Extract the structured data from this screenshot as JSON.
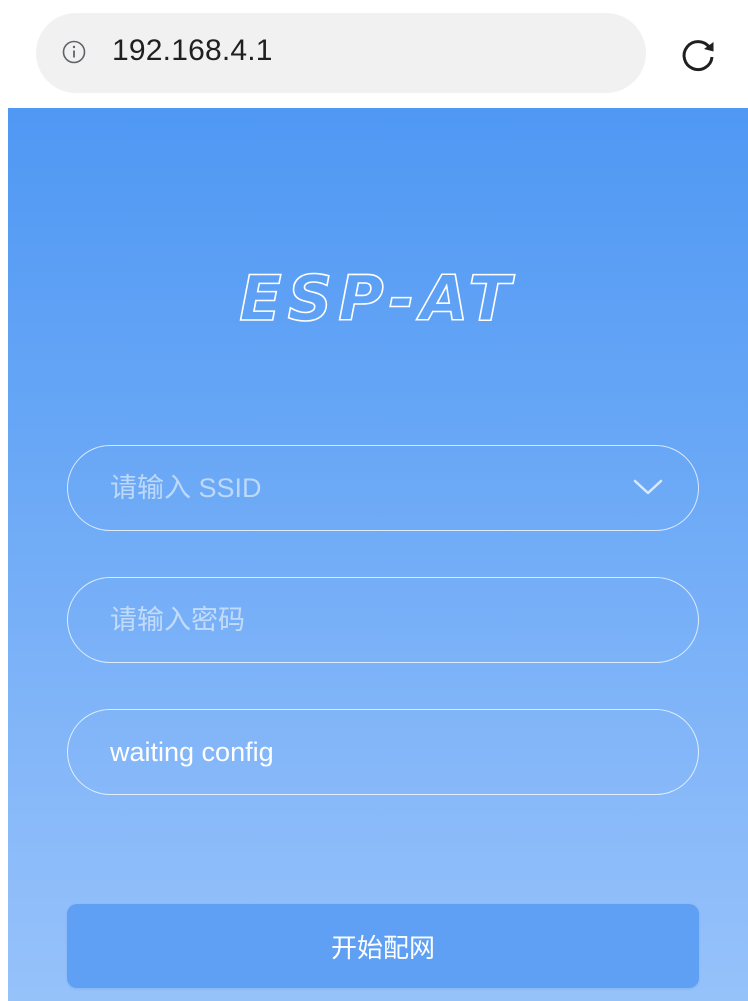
{
  "browser": {
    "url": "192.168.4.1",
    "info_icon": "info-icon",
    "reload_icon": "reload-icon"
  },
  "page": {
    "logo_text": "ESP-AT",
    "ssid": {
      "placeholder": "请输入 SSID",
      "value": "",
      "dropdown_icon": "chevron-down-icon"
    },
    "password": {
      "placeholder": "请输入密码",
      "value": ""
    },
    "status": {
      "text": "waiting config"
    },
    "submit_label": "开始配网"
  },
  "colors": {
    "gradient_top": "#4f98f4",
    "gradient_bottom": "#96c2fa",
    "button": "#5fa0f4",
    "text": "#ffffff"
  }
}
